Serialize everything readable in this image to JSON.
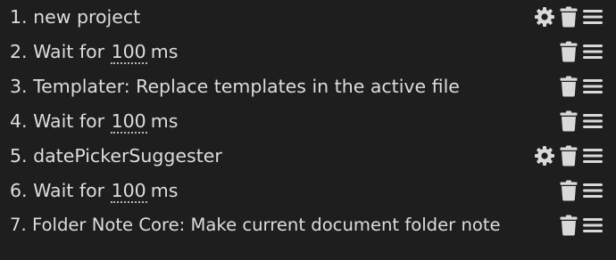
{
  "commands": [
    {
      "index": "1.",
      "text": "new project",
      "has_settings": true
    },
    {
      "index": "2.",
      "prefix": "Wait for",
      "value": "100",
      "suffix": "ms",
      "has_settings": false
    },
    {
      "index": "3.",
      "text": "Templater: Replace templates in the active file",
      "has_settings": false
    },
    {
      "index": "4.",
      "prefix": "Wait for",
      "value": "100",
      "suffix": "ms",
      "has_settings": false
    },
    {
      "index": "5.",
      "text": "datePickerSuggester",
      "has_settings": true
    },
    {
      "index": "6.",
      "prefix": "Wait for",
      "value": "100",
      "suffix": "ms",
      "has_settings": false
    },
    {
      "index": "7.",
      "text": "Folder Note Core: Make current document folder note",
      "has_settings": false
    }
  ],
  "icons": {
    "settings": "gear-icon",
    "delete": "trash-icon",
    "drag": "drag-handle-icon"
  },
  "colors": {
    "background": "#1e1e1e",
    "text": "#dcddde",
    "icon": "#d9d9d9"
  }
}
